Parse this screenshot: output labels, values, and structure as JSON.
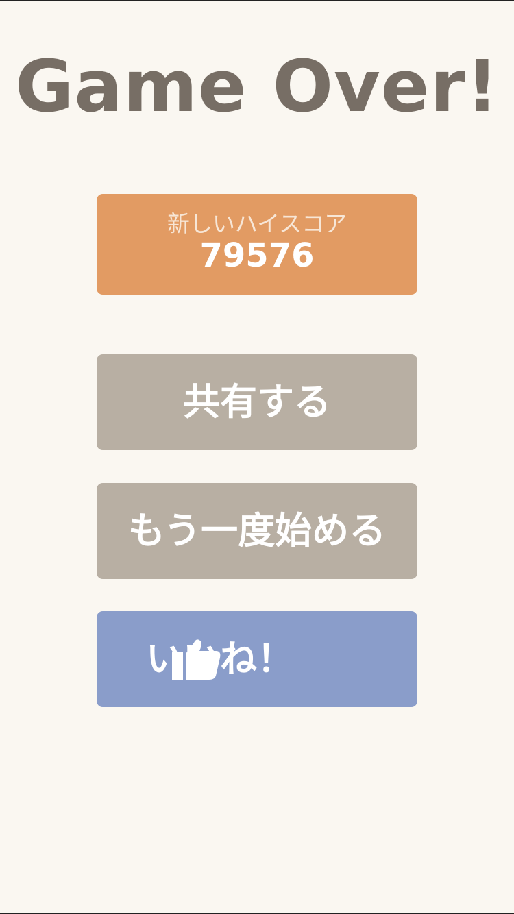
{
  "title": "Game Over!",
  "score": {
    "label": "新しいハイスコア",
    "value": "79576"
  },
  "buttons": {
    "share": "共有する",
    "retry": "もう一度始める",
    "like": "いいね！"
  },
  "icons": {
    "like": "thumbs-up-icon"
  },
  "colors": {
    "background": "#faf7f1",
    "title": "#776e65",
    "score_box": "#e29b63",
    "button": "#b8afa3",
    "like_button": "#8a9dca"
  }
}
